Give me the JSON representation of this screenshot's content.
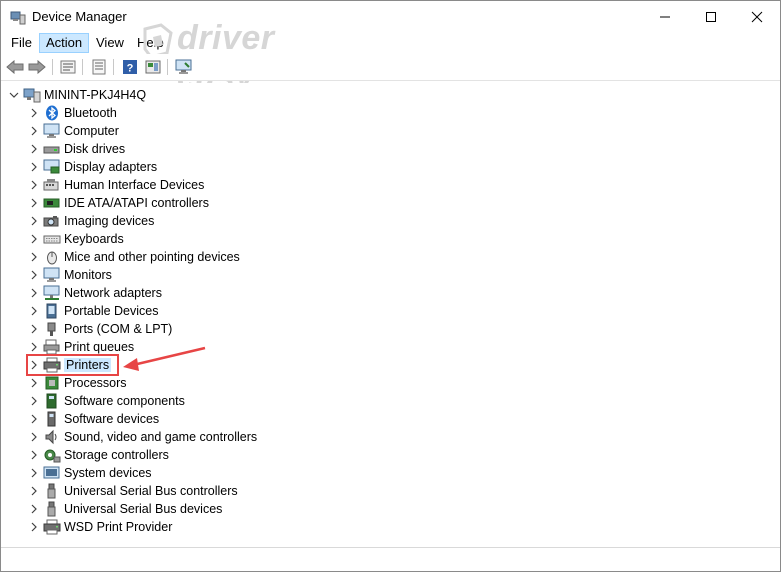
{
  "window": {
    "title": "Device Manager",
    "icon": "device-manager-icon",
    "controls": [
      "minimize-icon",
      "maximize-icon",
      "close-icon"
    ]
  },
  "menu": {
    "items": [
      "File",
      "Action",
      "View",
      "Help"
    ],
    "active": "Action"
  },
  "watermark": {
    "brand": "driver easy",
    "url": "www.DriverEasy.com"
  },
  "toolbar": {
    "buttons": [
      "back-icon",
      "forward-icon",
      "properties-icon",
      "update-icon",
      "help-icon",
      "show-hide-icon",
      "monitor-icon"
    ]
  },
  "tree": {
    "root": "MININT-PKJ4H4Q",
    "items": [
      {
        "label": "Bluetooth",
        "icon": "bluetooth-icon"
      },
      {
        "label": "Computer",
        "icon": "computer-icon"
      },
      {
        "label": "Disk drives",
        "icon": "disk-drive-icon"
      },
      {
        "label": "Display adapters",
        "icon": "display-adapter-icon"
      },
      {
        "label": "Human Interface Devices",
        "icon": "hid-icon"
      },
      {
        "label": "IDE ATA/ATAPI controllers",
        "icon": "ide-controller-icon"
      },
      {
        "label": "Imaging devices",
        "icon": "camera-icon"
      },
      {
        "label": "Keyboards",
        "icon": "keyboard-icon"
      },
      {
        "label": "Mice and other pointing devices",
        "icon": "mouse-icon"
      },
      {
        "label": "Monitors",
        "icon": "monitor-icon"
      },
      {
        "label": "Network adapters",
        "icon": "network-adapter-icon"
      },
      {
        "label": "Portable Devices",
        "icon": "portable-device-icon"
      },
      {
        "label": "Ports (COM & LPT)",
        "icon": "port-icon"
      },
      {
        "label": "Print queues",
        "icon": "print-queue-icon"
      },
      {
        "label": "Printers",
        "icon": "printer-icon"
      },
      {
        "label": "Processors",
        "icon": "processor-icon"
      },
      {
        "label": "Software components",
        "icon": "software-component-icon"
      },
      {
        "label": "Software devices",
        "icon": "software-device-icon"
      },
      {
        "label": "Sound, video and game controllers",
        "icon": "speaker-icon"
      },
      {
        "label": "Storage controllers",
        "icon": "storage-controller-icon"
      },
      {
        "label": "System devices",
        "icon": "system-device-icon"
      },
      {
        "label": "Universal Serial Bus controllers",
        "icon": "usb-icon"
      },
      {
        "label": "Universal Serial Bus devices",
        "icon": "usb-icon"
      },
      {
        "label": "WSD Print Provider",
        "icon": "printer-icon"
      }
    ],
    "highlighted": "Printers"
  },
  "annotation": {
    "color": "#e74545"
  }
}
